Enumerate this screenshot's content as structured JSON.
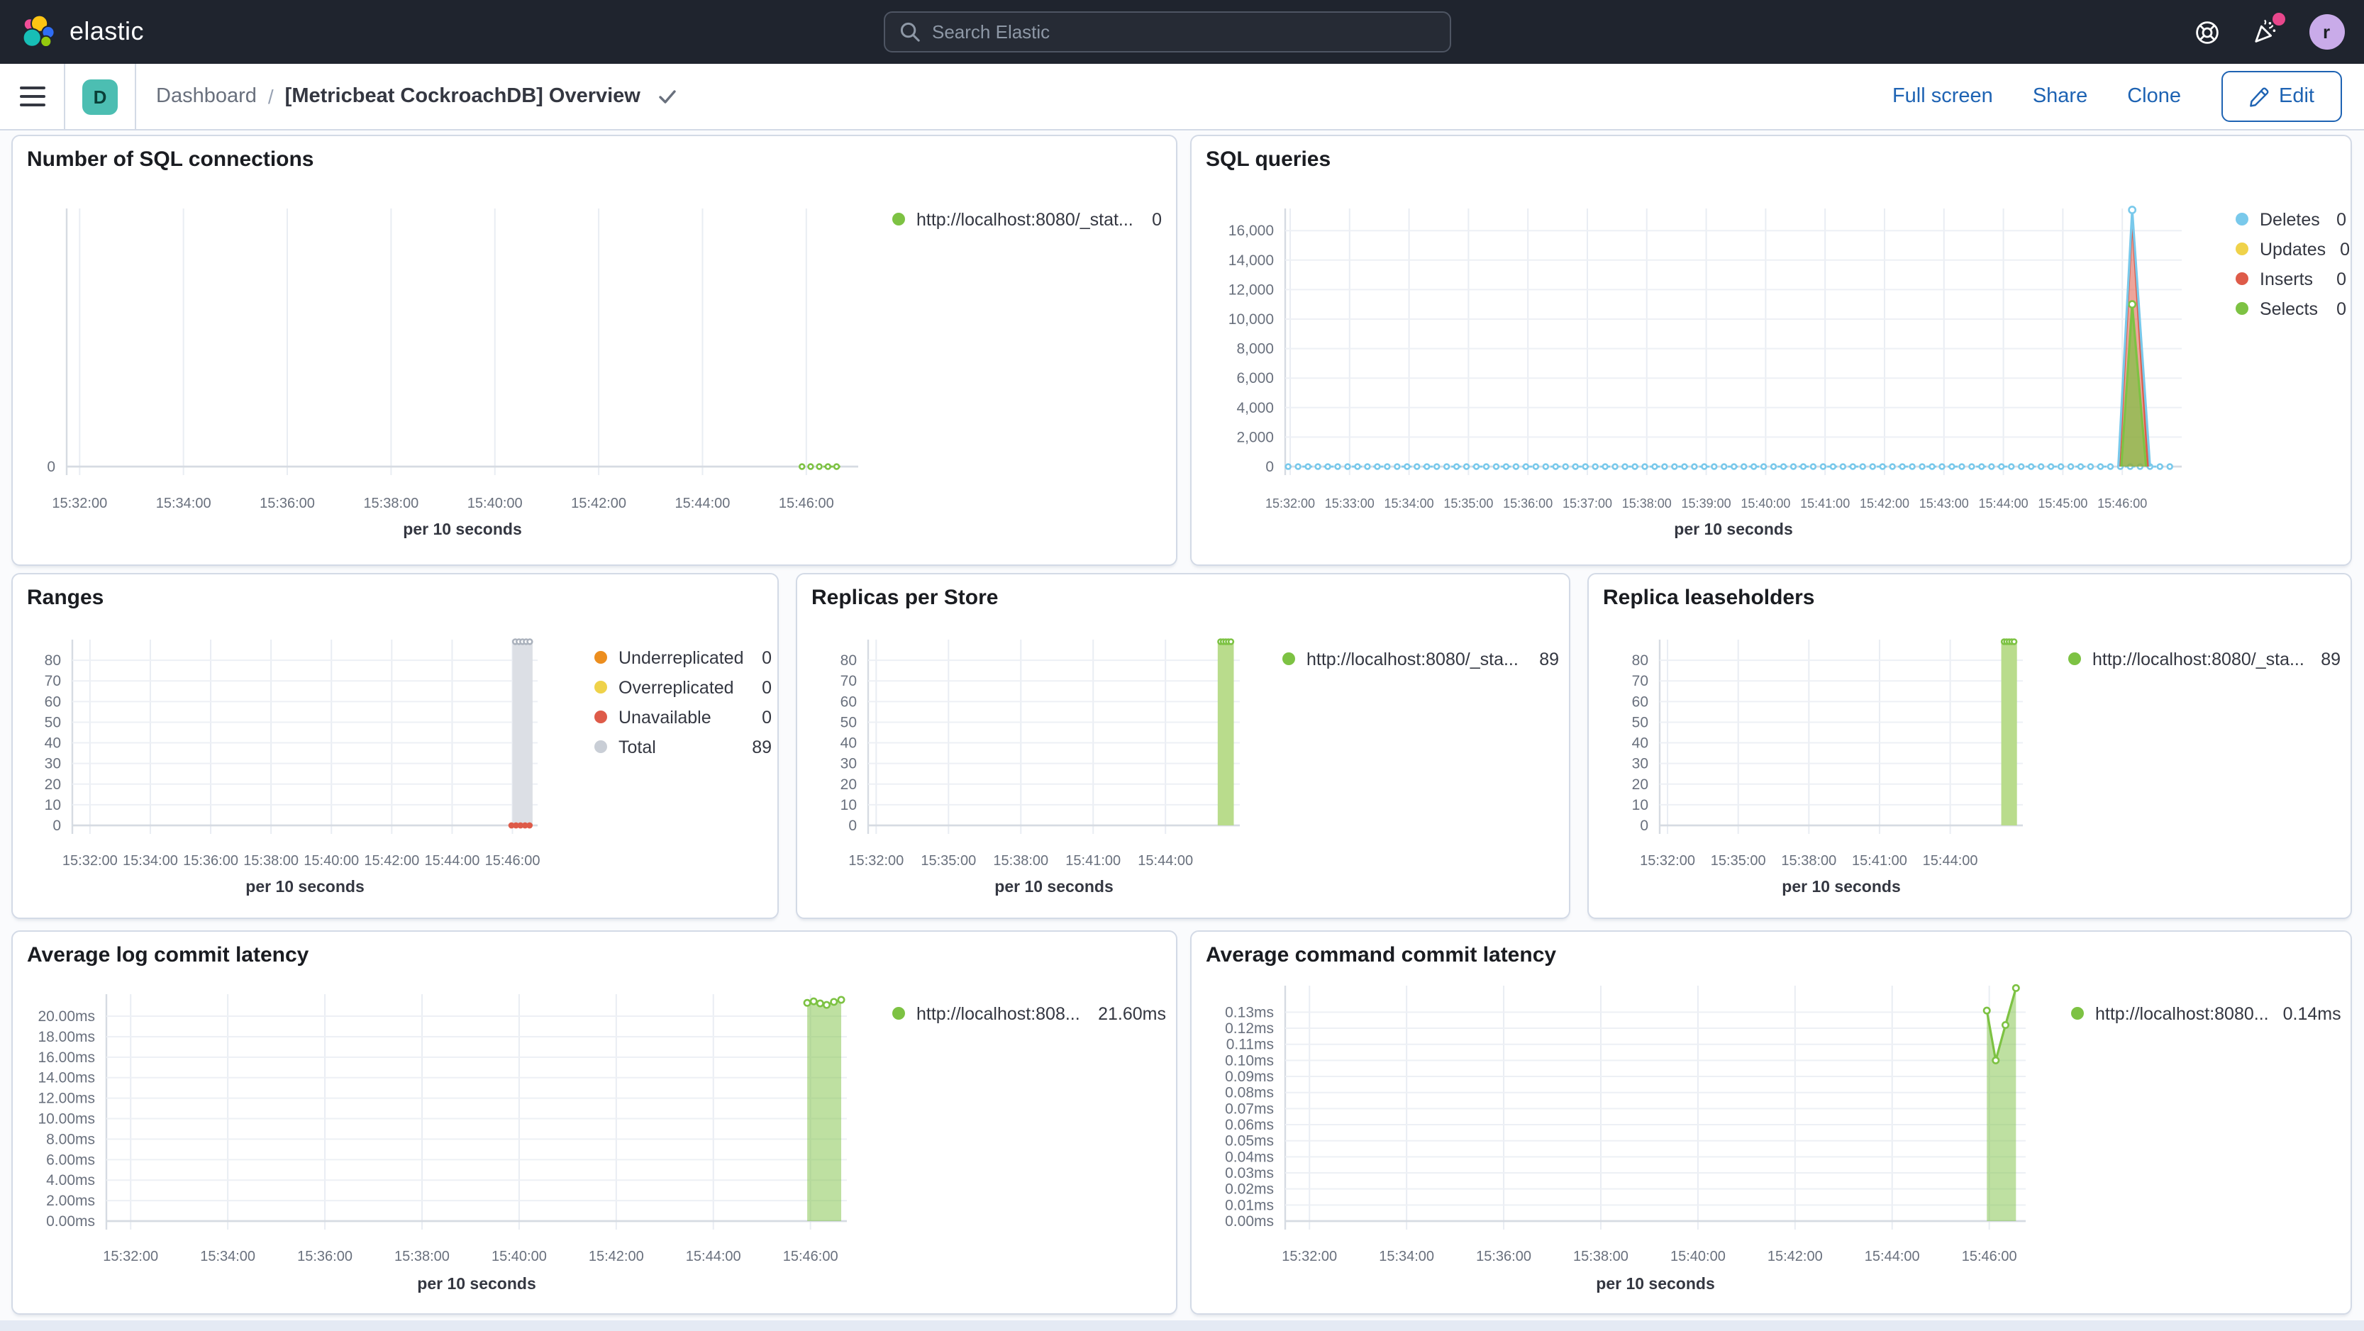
{
  "topbar": {
    "brand": "elastic",
    "search_placeholder": "Search Elastic",
    "avatar_initial": "r",
    "notification_color": "#E8478C"
  },
  "nav": {
    "space_initial": "D",
    "dashboard": "Dashboard",
    "separator": "/",
    "title": "[Metricbeat CockroachDB] Overview",
    "full_screen": "Full screen",
    "share": "Share",
    "clone": "Clone",
    "edit": "Edit"
  },
  "panels": [
    {
      "title": "Number of SQL connections",
      "legend": [
        {
          "label": "http://localhost:8080/_stat...",
          "value": "0",
          "color": "#7DC243"
        }
      ],
      "chart_data": {
        "type": "line",
        "title": "Number of SQL connections",
        "xlabel": "per 10 seconds",
        "legend_position": "right",
        "x_domain": [
          "15:31:45",
          "15:47:00"
        ],
        "x_ticks": [
          "15:32:00",
          "15:34:00",
          "15:36:00",
          "15:38:00",
          "15:40:00",
          "15:42:00",
          "15:44:00",
          "15:46:00"
        ],
        "y_ticks": [
          {
            "v": 0,
            "label": "0"
          }
        ],
        "y_max": 10,
        "series": [
          {
            "name": "http://localhost:8080/_stat...",
            "kind": "dotted-flat",
            "color": "#7DC243",
            "t0": "15:45:55",
            "t1": "15:46:42",
            "value": 0,
            "marker_every_s": 10
          }
        ]
      }
    },
    {
      "title": "SQL queries",
      "legend": [
        {
          "label": "Deletes",
          "value": "0",
          "color": "#79C9EB"
        },
        {
          "label": "Updates",
          "value": "0",
          "color": "#EFD24A"
        },
        {
          "label": "Inserts",
          "value": "0",
          "color": "#DE5B49"
        },
        {
          "label": "Selects",
          "value": "0",
          "color": "#7DC243"
        }
      ],
      "chart_data": {
        "type": "line",
        "title": "SQL queries",
        "xlabel": "per 10 seconds",
        "legend_position": "right",
        "x_domain": [
          "15:31:55",
          "15:47:00"
        ],
        "x_ticks": [
          "15:32:00",
          "15:33:00",
          "15:34:00",
          "15:35:00",
          "15:36:00",
          "15:37:00",
          "15:38:00",
          "15:39:00",
          "15:40:00",
          "15:41:00",
          "15:42:00",
          "15:43:00",
          "15:44:00",
          "15:45:00",
          "15:46:00"
        ],
        "y_ticks": [
          {
            "v": 0,
            "label": "0"
          },
          {
            "v": 2000,
            "label": "2,000"
          },
          {
            "v": 4000,
            "label": "4,000"
          },
          {
            "v": 6000,
            "label": "6,000"
          },
          {
            "v": 8000,
            "label": "8,000"
          },
          {
            "v": 10000,
            "label": "10,000"
          },
          {
            "v": 12000,
            "label": "12,000"
          },
          {
            "v": 14000,
            "label": "14,000"
          },
          {
            "v": 16000,
            "label": "16,000"
          }
        ],
        "y_max": 17500,
        "series": [
          {
            "name": "Deletes",
            "kind": "dotted-flat",
            "color": "#79C9EB",
            "t0": "15:31:58",
            "t1": "15:46:52",
            "value": 0,
            "marker_every_s": 10
          },
          {
            "name": "Inserts",
            "kind": "spike",
            "color": "#DE5B49",
            "fill": "rgba(222,91,73,0.55)",
            "points": [
              [
                "15:45:57",
                0
              ],
              [
                "15:46:10",
                16900
              ],
              [
                "15:46:26",
                0
              ]
            ]
          },
          {
            "name": "Selects",
            "kind": "spike",
            "color": "#7DC243",
            "fill": "rgba(125,194,67,0.7)",
            "points": [
              [
                "15:45:59",
                0
              ],
              [
                "15:46:10",
                11000
              ],
              [
                "15:46:24",
                0
              ]
            ],
            "markers": [
              1
            ]
          },
          {
            "name": "Deletes",
            "kind": "spike",
            "color": "#79C9EB",
            "points": [
              [
                "15:45:56",
                0
              ],
              [
                "15:46:10",
                17400
              ],
              [
                "15:46:28",
                0
              ]
            ],
            "markers": [
              1
            ]
          }
        ]
      }
    },
    {
      "title": "Ranges",
      "legend": [
        {
          "label": "Underreplicated",
          "value": "0",
          "color": "#EC8E1F"
        },
        {
          "label": "Overreplicated",
          "value": "0",
          "color": "#EFD24A"
        },
        {
          "label": "Unavailable",
          "value": "0",
          "color": "#DE5B49"
        },
        {
          "label": "Total",
          "value": "89",
          "color": "#C9CED6"
        }
      ],
      "chart_data": {
        "type": "bar",
        "title": "Ranges",
        "xlabel": "per 10 seconds",
        "legend_position": "right",
        "x_domain": [
          "15:31:25",
          "15:46:50"
        ],
        "x_ticks": [
          "15:32:00",
          "15:34:00",
          "15:36:00",
          "15:38:00",
          "15:40:00",
          "15:42:00",
          "15:44:00",
          "15:46:00"
        ],
        "y_ticks": [
          {
            "v": 0,
            "label": "0"
          },
          {
            "v": 10,
            "label": "10"
          },
          {
            "v": 20,
            "label": "20"
          },
          {
            "v": 30,
            "label": "30"
          },
          {
            "v": 40,
            "label": "40"
          },
          {
            "v": 50,
            "label": "50"
          },
          {
            "v": 60,
            "label": "60"
          },
          {
            "v": 70,
            "label": "70"
          },
          {
            "v": 80,
            "label": "80"
          }
        ],
        "y_max": 90,
        "series": [
          {
            "name": "Total",
            "kind": "bar",
            "color": "#DCDFE5",
            "t": "15:46:20",
            "halfwidth_s": 20,
            "value": 89,
            "caps": 5,
            "cap_color": "#ABB2BD"
          },
          {
            "name": "Unavailable",
            "kind": "dots",
            "color": "#DE5B49",
            "t0": "15:45:58",
            "t1": "15:46:34",
            "value": 0,
            "every_s": 9,
            "r": 2.2
          }
        ]
      }
    },
    {
      "title": "Replicas per Store",
      "legend": [
        {
          "label": "http://localhost:8080/_sta...",
          "value": "89",
          "color": "#7DC243"
        }
      ],
      "chart_data": {
        "type": "bar",
        "title": "Replicas per Store",
        "xlabel": "per 10 seconds",
        "legend_position": "right",
        "x_domain": [
          "15:31:40",
          "15:47:05"
        ],
        "x_ticks": [
          "15:32:00",
          "15:35:00",
          "15:38:00",
          "15:41:00",
          "15:44:00"
        ],
        "y_ticks": [
          {
            "v": 0,
            "label": "0"
          },
          {
            "v": 10,
            "label": "10"
          },
          {
            "v": 20,
            "label": "20"
          },
          {
            "v": 30,
            "label": "30"
          },
          {
            "v": 40,
            "label": "40"
          },
          {
            "v": 50,
            "label": "50"
          },
          {
            "v": 60,
            "label": "60"
          },
          {
            "v": 70,
            "label": "70"
          },
          {
            "v": 80,
            "label": "80"
          }
        ],
        "y_max": 90,
        "series": [
          {
            "name": "http://localhost:8080/_sta...",
            "kind": "bar",
            "color": "#B9DC8C",
            "t": "15:46:30",
            "halfwidth_s": 20,
            "value": 89,
            "caps": 5,
            "cap_color": "#7DC243"
          }
        ]
      }
    },
    {
      "title": "Replica leaseholders",
      "legend": [
        {
          "label": "http://localhost:8080/_sta...",
          "value": "89",
          "color": "#7DC243"
        }
      ],
      "chart_data": {
        "type": "bar",
        "title": "Replica leaseholders",
        "xlabel": "per 10 seconds",
        "legend_position": "right",
        "x_domain": [
          "15:31:40",
          "15:47:05"
        ],
        "x_ticks": [
          "15:32:00",
          "15:35:00",
          "15:38:00",
          "15:41:00",
          "15:44:00"
        ],
        "y_ticks": [
          {
            "v": 0,
            "label": "0"
          },
          {
            "v": 10,
            "label": "10"
          },
          {
            "v": 20,
            "label": "20"
          },
          {
            "v": 30,
            "label": "30"
          },
          {
            "v": 40,
            "label": "40"
          },
          {
            "v": 50,
            "label": "50"
          },
          {
            "v": 60,
            "label": "60"
          },
          {
            "v": 70,
            "label": "70"
          },
          {
            "v": 80,
            "label": "80"
          }
        ],
        "y_max": 90,
        "series": [
          {
            "name": "http://localhost:8080/_sta...",
            "kind": "bar",
            "color": "#B9DC8C",
            "t": "15:46:30",
            "halfwidth_s": 20,
            "value": 89,
            "caps": 5,
            "cap_color": "#7DC243"
          }
        ]
      }
    },
    {
      "title": "Average log commit latency",
      "legend": [
        {
          "label": "http://localhost:808...",
          "value": "21.60ms",
          "color": "#7DC243"
        }
      ],
      "chart_data": {
        "type": "area",
        "title": "Average log commit latency",
        "xlabel": "per 10 seconds",
        "legend_position": "right",
        "x_domain": [
          "15:31:30",
          "15:46:45"
        ],
        "x_ticks": [
          "15:32:00",
          "15:34:00",
          "15:36:00",
          "15:38:00",
          "15:40:00",
          "15:42:00",
          "15:44:00",
          "15:46:00"
        ],
        "y_ticks": [
          {
            "v": 0,
            "label": "0.00ms"
          },
          {
            "v": 2,
            "label": "2.00ms"
          },
          {
            "v": 4,
            "label": "4.00ms"
          },
          {
            "v": 6,
            "label": "6.00ms"
          },
          {
            "v": 8,
            "label": "8.00ms"
          },
          {
            "v": 10,
            "label": "10.00ms"
          },
          {
            "v": 12,
            "label": "12.00ms"
          },
          {
            "v": 14,
            "label": "14.00ms"
          },
          {
            "v": 16,
            "label": "16.00ms"
          },
          {
            "v": 18,
            "label": "18.00ms"
          },
          {
            "v": 20,
            "label": "20.00ms"
          }
        ],
        "y_max": 22.15,
        "series": [
          {
            "name": "http://localhost:808...",
            "kind": "area",
            "color": "#7DC243",
            "fill": "rgba(125,194,67,0.5)",
            "points": [
              [
                "15:45:56",
                21.3
              ],
              [
                "15:46:04",
                21.45
              ],
              [
                "15:46:12",
                21.25
              ],
              [
                "15:46:20",
                21.1
              ],
              [
                "15:46:29",
                21.4
              ],
              [
                "15:46:38",
                21.6
              ]
            ]
          }
        ]
      }
    },
    {
      "title": "Average command commit latency",
      "legend": [
        {
          "label": "http://localhost:8080...",
          "value": "0.14ms",
          "color": "#7DC243"
        }
      ],
      "chart_data": {
        "type": "area",
        "title": "Average command commit latency",
        "xlabel": "per 10 seconds",
        "legend_position": "right",
        "x_domain": [
          "15:31:30",
          "15:46:45"
        ],
        "x_ticks": [
          "15:32:00",
          "15:34:00",
          "15:36:00",
          "15:38:00",
          "15:40:00",
          "15:42:00",
          "15:44:00",
          "15:46:00"
        ],
        "y_ticks": [
          {
            "v": 0,
            "label": "0.00ms"
          },
          {
            "v": 0.01,
            "label": "0.01ms"
          },
          {
            "v": 0.02,
            "label": "0.02ms"
          },
          {
            "v": 0.03,
            "label": "0.03ms"
          },
          {
            "v": 0.04,
            "label": "0.04ms"
          },
          {
            "v": 0.05,
            "label": "0.05ms"
          },
          {
            "v": 0.06,
            "label": "0.06ms"
          },
          {
            "v": 0.07,
            "label": "0.07ms"
          },
          {
            "v": 0.08,
            "label": "0.08ms"
          },
          {
            "v": 0.09,
            "label": "0.09ms"
          },
          {
            "v": 0.1,
            "label": "0.10ms"
          },
          {
            "v": 0.11,
            "label": "0.11ms"
          },
          {
            "v": 0.12,
            "label": "0.12ms"
          },
          {
            "v": 0.13,
            "label": "0.13ms"
          }
        ],
        "y_max": 0.1465,
        "series": [
          {
            "name": "http://localhost:8080...",
            "kind": "area",
            "color": "#7DC243",
            "fill": "rgba(125,194,67,0.5)",
            "points": [
              [
                "15:45:57",
                0.131
              ],
              [
                "15:46:08",
                0.1
              ],
              [
                "15:46:20",
                0.122
              ],
              [
                "15:46:33",
                0.145
              ]
            ]
          }
        ]
      }
    }
  ]
}
